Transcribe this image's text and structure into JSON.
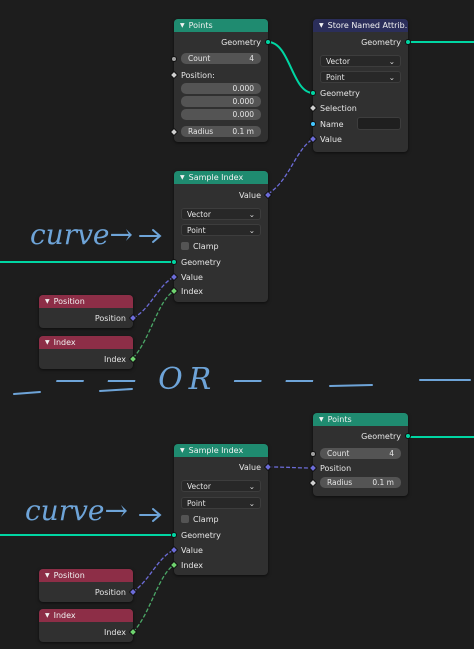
{
  "colors": {
    "geometry_header": "#1f8b70",
    "attribute_header": "#2b2e5a",
    "input_header": "#8d2e47",
    "background": "#1d1d1d",
    "wire_geometry": "#00d6a3",
    "wire_vector": "#6c6cd8",
    "wire_integer": "#4ba867",
    "annotation": "#6ea4d8"
  },
  "annotations": {
    "curve_top": "curve→",
    "curve_bottom": "curve→",
    "or": "— — OR — —"
  },
  "points_top": {
    "title": "Points",
    "geometry": "Geometry",
    "count_label": "Count",
    "count_value": "4",
    "position_label": "Position:",
    "pos_x": "0.000",
    "pos_y": "0.000",
    "pos_z": "0.000",
    "radius_label": "Radius",
    "radius_value": "0.1 m"
  },
  "store": {
    "title": "Store Named Attrib...",
    "geometry_out": "Geometry",
    "type": "Vector",
    "domain": "Point",
    "geometry_in": "Geometry",
    "selection": "Selection",
    "name": "Name",
    "name_value": "",
    "value": "Value"
  },
  "sample_top": {
    "title": "Sample Index",
    "value_out": "Value",
    "type": "Vector",
    "domain": "Point",
    "clamp": "Clamp",
    "geometry": "Geometry",
    "value_in": "Value",
    "index": "Index"
  },
  "position_top": {
    "title": "Position",
    "output": "Position"
  },
  "index_top": {
    "title": "Index",
    "output": "Index"
  },
  "points_bottom": {
    "title": "Points",
    "geometry": "Geometry",
    "count_label": "Count",
    "count_value": "4",
    "position": "Position",
    "radius_label": "Radius",
    "radius_value": "0.1 m"
  },
  "sample_bottom": {
    "title": "Sample Index",
    "value_out": "Value",
    "type": "Vector",
    "domain": "Point",
    "clamp": "Clamp",
    "geometry": "Geometry",
    "value_in": "Value",
    "index": "Index"
  },
  "position_bottom": {
    "title": "Position",
    "output": "Position"
  },
  "index_bottom": {
    "title": "Index",
    "output": "Index"
  }
}
